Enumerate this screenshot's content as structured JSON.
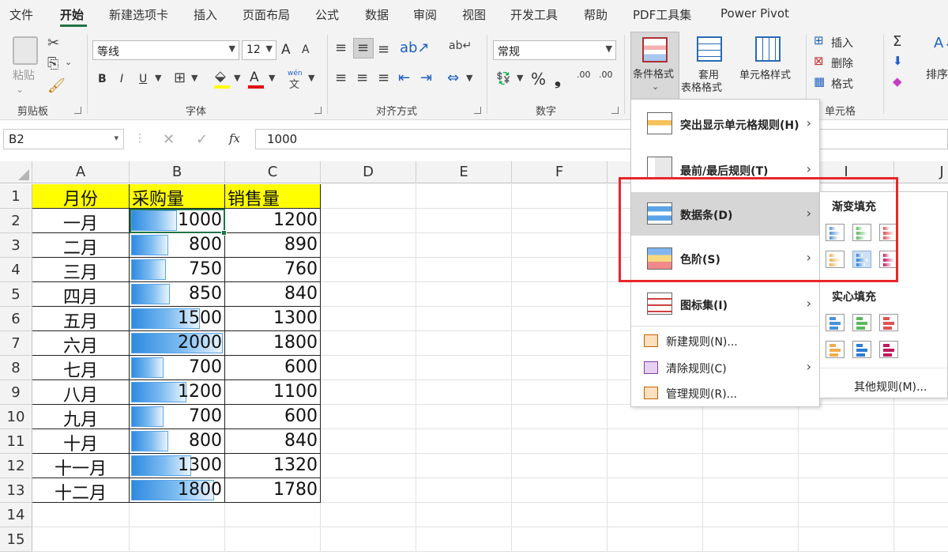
{
  "tabs": [
    "文件",
    "开始",
    "新建选项卡",
    "插入",
    "页面布局",
    "公式",
    "数据",
    "审阅",
    "视图",
    "开发工具",
    "帮助",
    "PDF工具集",
    "Power Pivot"
  ],
  "ribbon": {
    "clipboard": {
      "paste": "粘贴",
      "label": "剪贴板"
    },
    "font": {
      "name": "等线",
      "size": "12",
      "label": "字体",
      "grow": "A",
      "shrink": "A",
      "bold": "B",
      "italic": "I",
      "underline": "U",
      "font_color": "A",
      "phonetic": "wén"
    },
    "alignment": {
      "label": "对齐方式"
    },
    "number": {
      "format": "常规",
      "label": "数字",
      "percent": "%",
      "comma": "❟",
      "inc_dec": ".00",
      "dec_dec": ".00"
    },
    "styles": {
      "cond_format": "条件格式",
      "table_format_1": "套用",
      "table_format_2": "表格格式",
      "cell_styles": "单元格样式"
    },
    "cells": {
      "insert": "插入",
      "delete": "删除",
      "format": "格式",
      "label": "单元格"
    },
    "editing": {
      "sigma": "Σ",
      "sort": "排序"
    }
  },
  "formula_bar": {
    "name_box": "B2",
    "value": "1000",
    "fx": "fx"
  },
  "columns": [
    "A",
    "B",
    "C",
    "D",
    "E",
    "F",
    "G",
    "H",
    "I",
    "J"
  ],
  "rows": [
    "1",
    "2",
    "3",
    "4",
    "5",
    "6",
    "7",
    "8",
    "9",
    "10",
    "11",
    "12",
    "13",
    "14",
    "15"
  ],
  "table": {
    "headers": [
      "月份",
      "采购量",
      "销售量"
    ],
    "rows": [
      {
        "month": "一月",
        "purchase": 1000,
        "sales": "1200"
      },
      {
        "month": "二月",
        "purchase": 800,
        "sales": "890"
      },
      {
        "month": "三月",
        "purchase": 750,
        "sales": "760"
      },
      {
        "month": "四月",
        "purchase": 850,
        "sales": "840"
      },
      {
        "month": "五月",
        "purchase": 1500,
        "sales": "1300"
      },
      {
        "month": "六月",
        "purchase": 2000,
        "sales": "1800"
      },
      {
        "month": "七月",
        "purchase": 700,
        "sales": "600"
      },
      {
        "month": "八月",
        "purchase": 1200,
        "sales": "1100"
      },
      {
        "month": "九月",
        "purchase": 700,
        "sales": "600"
      },
      {
        "month": "十月",
        "purchase": 800,
        "sales": "840"
      },
      {
        "month": "十一月",
        "purchase": 1300,
        "sales": "1320"
      },
      {
        "month": "十二月",
        "purchase": 1800,
        "sales": "1780"
      }
    ]
  },
  "cond_menu": {
    "items": [
      "突出显示单元格规则(H)",
      "最前/最后规则(T)",
      "数据条(D)",
      "色阶(S)",
      "图标集(I)"
    ],
    "simple": [
      "新建规则(N)...",
      "清除规则(C)",
      "管理规则(R)..."
    ]
  },
  "databar_submenu": {
    "gradient_title": "渐变填充",
    "solid_title": "实心填充",
    "more": "其他规则(M)...",
    "colors": [
      "#4a90d9",
      "#5cb85c",
      "#e05252",
      "#f0ad4e",
      "#2b7cd3",
      "#c2185b"
    ]
  },
  "accent": "#217346",
  "highlight_color": "#e8262b"
}
